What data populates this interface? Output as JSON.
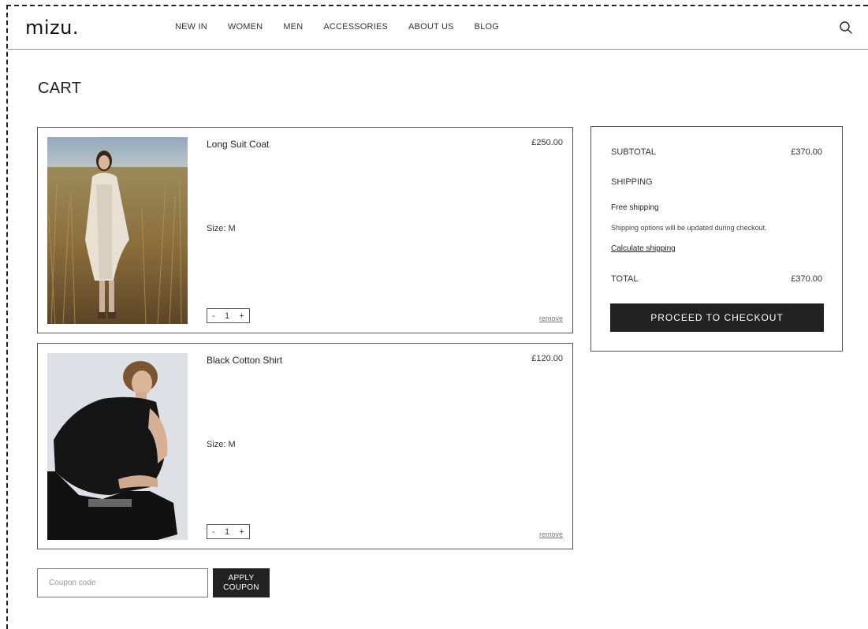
{
  "brand": {
    "logo": "mizu."
  },
  "nav": {
    "items": [
      {
        "label": "NEW IN"
      },
      {
        "label": "WOMEN"
      },
      {
        "label": "MEN"
      },
      {
        "label": "ACCESSORIES"
      },
      {
        "label": "ABOUT US"
      },
      {
        "label": "BLOG"
      }
    ],
    "search_icon": "search-icon"
  },
  "page": {
    "title": "CART"
  },
  "cart": {
    "items": [
      {
        "name": "Long Suit Coat",
        "price": "£250.00",
        "size_label": "Size:",
        "size": "M",
        "quantity": "1",
        "decrement": "-",
        "increment": "+",
        "remove_label": "remove",
        "image": "photo-woman-white-coat-field"
      },
      {
        "name": "Black Cotton Shirt",
        "price": "£120.00",
        "size_label": "Size:",
        "size": "M",
        "quantity": "1",
        "decrement": "-",
        "increment": "+",
        "remove_label": "remove",
        "image": "photo-man-black-shirt"
      }
    ]
  },
  "summary": {
    "subtotal_label": "SUBTOTAL",
    "subtotal_value": "£370.00",
    "shipping_label": "SHIPPING",
    "shipping_method": "Free shipping",
    "shipping_note": "Shipping options will be updated during checkout.",
    "calculate_link": "Calculate shipping",
    "total_label": "TOTAL",
    "total_value": "£370.00",
    "checkout_label": "PROCEED TO CHECKOUT"
  },
  "coupon": {
    "placeholder": "Coupon code",
    "apply_line1": "APPLY",
    "apply_line2": "COUPON"
  },
  "colors": {
    "primary": "#222222",
    "border": "#555555",
    "background": "#ffffff"
  }
}
